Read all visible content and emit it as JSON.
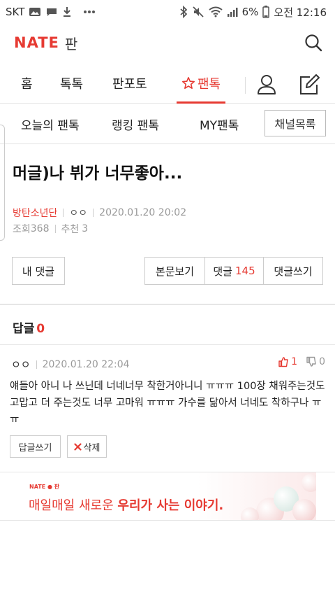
{
  "status": {
    "carrier": "SKT",
    "battery": "6%",
    "time": "오전 12:16"
  },
  "app": {
    "brand": "NATE",
    "section": "판"
  },
  "nav": {
    "items": [
      "홈",
      "톡톡",
      "판포토",
      "팬톡"
    ]
  },
  "subnav": {
    "items": [
      "오늘의 팬톡",
      "랭킹 팬톡",
      "MY팬톡"
    ],
    "channel_button": "채널목록"
  },
  "post": {
    "title": "머글)나 뷔가 너무좋아...",
    "author": "방탄소년단",
    "nickname": "ㅇㅇ",
    "datetime": "2020.01.20 20:02",
    "views_label": "조회",
    "views": "368",
    "recommend_label": "추천",
    "recommend": "3"
  },
  "actions": {
    "my_comments": "내 댓글",
    "view_post": "본문보기",
    "comments_label": "댓글",
    "comments_count": "145",
    "write_comment": "댓글쓰기"
  },
  "replies": {
    "label": "답글",
    "count": "0"
  },
  "comment": {
    "author": "ㅇㅇ",
    "datetime": "2020.01.20 22:04",
    "upvotes": "1",
    "downvotes": "0",
    "text": "얘들아 아니 나 쓰닌데 너네너무 착한거아니니 ㅠㅠㅠ 100장 채워주는것도 고맙고 더 주는것도 너무 고마워 ㅠㅠㅠ 가수를 닮아서 너네도 착하구나 ㅠㅠ",
    "reply_button": "답글쓰기",
    "delete_button": "삭제"
  },
  "banner": {
    "logo": "NATE ● 판",
    "text_prefix": "매일매일 새로운",
    "text_bold": "우리가 사는 이야기."
  },
  "colors": {
    "accent": "#e63a32"
  }
}
